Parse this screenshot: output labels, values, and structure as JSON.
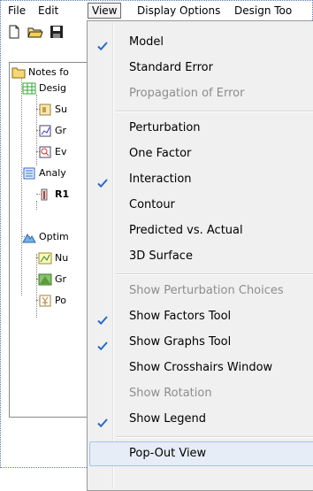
{
  "menubar": {
    "items": [
      "File",
      "Edit",
      "View",
      "Display Options",
      "Design Too"
    ],
    "active": "View"
  },
  "tree": {
    "nodes": [
      "Notes fo",
      "Desig",
      "Su",
      "Gr",
      "Ev",
      "Analy",
      "R1",
      "Optim",
      "Nu",
      "Gr",
      "Po"
    ]
  },
  "view_menu": {
    "items": [
      {
        "label": "Model",
        "checked": true,
        "enabled": true
      },
      {
        "label": "Standard Error",
        "checked": false,
        "enabled": true
      },
      {
        "label": "Propagation of Error",
        "checked": false,
        "enabled": false
      },
      {
        "label": "Perturbation",
        "checked": false,
        "enabled": true
      },
      {
        "label": "One Factor",
        "checked": false,
        "enabled": true
      },
      {
        "label": "Interaction",
        "checked": true,
        "enabled": true
      },
      {
        "label": "Contour",
        "checked": false,
        "enabled": true
      },
      {
        "label": "Predicted vs. Actual",
        "checked": false,
        "enabled": true
      },
      {
        "label": "3D Surface",
        "checked": false,
        "enabled": true
      },
      {
        "label": "Show Perturbation Choices",
        "checked": false,
        "enabled": false
      },
      {
        "label": "Show Factors Tool",
        "checked": true,
        "enabled": true
      },
      {
        "label": "Show Graphs Tool",
        "checked": true,
        "enabled": true
      },
      {
        "label": "Show Crosshairs Window",
        "checked": false,
        "enabled": true
      },
      {
        "label": "Show Rotation",
        "checked": false,
        "enabled": false
      },
      {
        "label": "Show Legend",
        "checked": true,
        "enabled": true
      },
      {
        "label": "Pop-Out View",
        "checked": false,
        "enabled": true,
        "highlighted": true
      }
    ]
  },
  "colors": {
    "check": "#2b67c7",
    "disabled_text": "#8d8d8d",
    "menu_bg": "#f0f0f0",
    "highlight_bg": "#e6edf6",
    "highlight_border": "#a8c3e6"
  },
  "icons": [
    "new-document-icon",
    "open-folder-icon",
    "save-icon",
    "notes-folder-icon",
    "design-icon",
    "summary-icon",
    "graph-icon",
    "evaluation-icon",
    "analysis-icon",
    "response-icon",
    "optimization-icon",
    "numerical-icon",
    "graphical-icon",
    "point-prediction-icon",
    "checkmark-icon"
  ]
}
